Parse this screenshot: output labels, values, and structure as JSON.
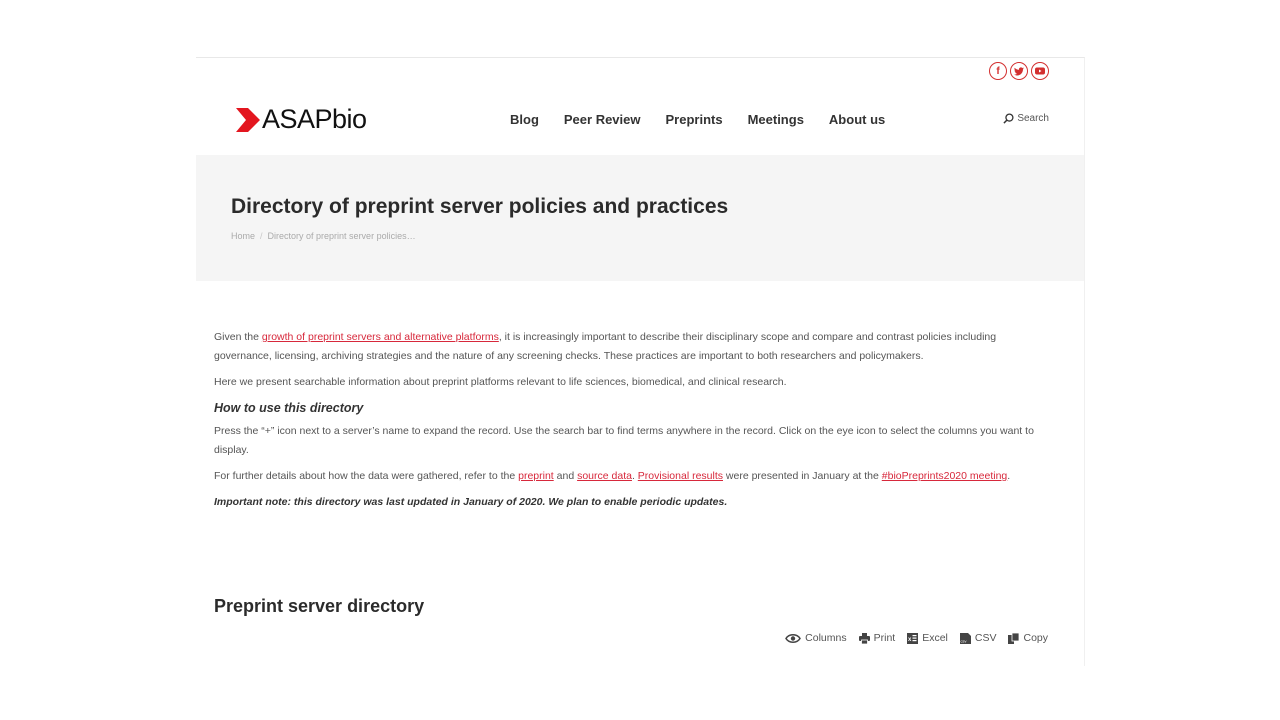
{
  "colors": {
    "accent": "#d7283b",
    "brand_red": "#e3161f",
    "title_bg": "#f5f5f5"
  },
  "social": [
    {
      "name": "facebook",
      "glyph": "f"
    },
    {
      "name": "twitter",
      "glyph": "t"
    },
    {
      "name": "youtube",
      "glyph": "▶"
    }
  ],
  "header": {
    "logo_text": "ASAPbio",
    "nav": [
      "Blog",
      "Peer Review",
      "Preprints",
      "Meetings",
      "About us"
    ],
    "search_label": "Search"
  },
  "titlebar": {
    "title": "Directory of preprint server policies and practices",
    "breadcrumb": {
      "home": "Home",
      "separator": "/",
      "current": "Directory of preprint server policies…"
    }
  },
  "content": {
    "p1_before": "Given the ",
    "p1_link": "growth of preprint servers and alternative platforms",
    "p1_after": ", it is increasingly important to describe their disciplinary scope and compare and contrast policies including governance, licensing, archiving strategies and the nature of any screening checks. These practices are important to both researchers and policymakers.",
    "p2": "Here we present searchable information about preprint platforms relevant to life sciences, biomedical, and clinical research.",
    "how_heading": "How to use this directory",
    "p3": "Press the “+” icon next to a server’s name to expand the record. Use the search bar to find terms anywhere in the record. Click on the eye icon to select the columns you want to display.",
    "p4_a": "For further details about how the data were gathered, refer to the ",
    "p4_link1": "preprint",
    "p4_b": " and ",
    "p4_link2": "source data",
    "p4_c": ". ",
    "p4_link3": "Provisional results",
    "p4_d": " were presented in January at the ",
    "p4_link4": "#bioPreprints2020 meeting",
    "p4_e": ".",
    "note": "Important note: this directory was last updated in January of 2020. We plan to enable periodic updates."
  },
  "directory": {
    "title": "Preprint server directory",
    "tools": [
      {
        "label": "Columns",
        "icon": "eye-icon"
      },
      {
        "label": "Print",
        "icon": "print-icon"
      },
      {
        "label": "Excel",
        "icon": "excel-icon"
      },
      {
        "label": "CSV",
        "icon": "csv-icon"
      },
      {
        "label": "Copy",
        "icon": "copy-icon"
      }
    ]
  }
}
